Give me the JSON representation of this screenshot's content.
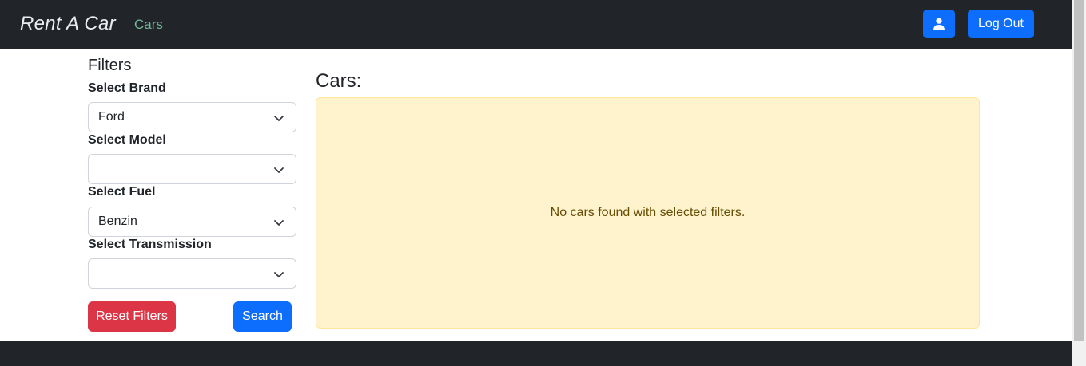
{
  "navbar": {
    "brand": "Rent A Car",
    "cars_link": "Cars",
    "logout_label": "Log Out"
  },
  "filters": {
    "title": "Filters",
    "brand_label": "Select Brand",
    "brand_value": "Ford",
    "model_label": "Select Model",
    "model_value": "",
    "fuel_label": "Select Fuel",
    "fuel_value": "Benzin",
    "transmission_label": "Select Transmission",
    "transmission_value": "",
    "reset_label": "Reset Filters",
    "search_label": "Search"
  },
  "main": {
    "heading": "Cars:",
    "empty_message": "No cars found with selected filters."
  },
  "icons": {
    "profile": "user-icon",
    "dropdown": "chevron-down-icon"
  },
  "colors": {
    "primary": "#0d6efd",
    "danger": "#dc3545",
    "dark": "#212529",
    "warning_bg": "#fff3cd",
    "nav_link": "#75b798"
  }
}
